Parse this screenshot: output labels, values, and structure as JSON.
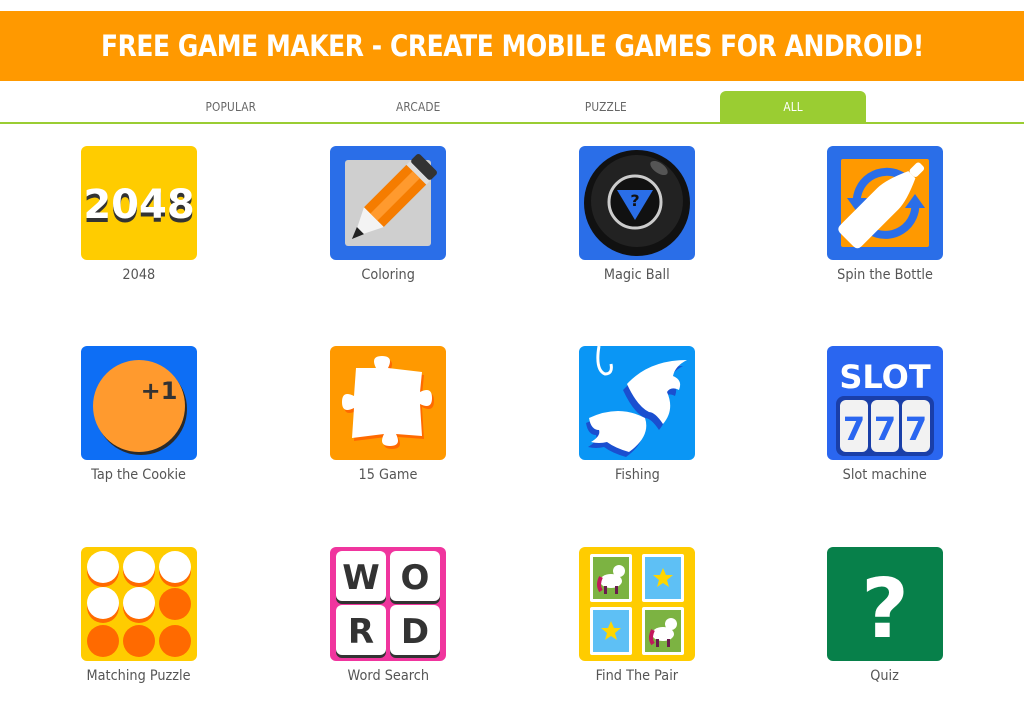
{
  "banner": {
    "title": "FREE GAME MAKER - CREATE MOBILE GAMES FOR ANDROID!"
  },
  "tabs": [
    {
      "label": "POPULAR",
      "active": false
    },
    {
      "label": "ARCADE",
      "active": false
    },
    {
      "label": "PUZZLE",
      "active": false
    },
    {
      "label": "ALL",
      "active": true
    }
  ],
  "colors": {
    "banner": "#ff9900",
    "tab_active": "#9acd32",
    "label_text": "#555555"
  },
  "games": [
    {
      "name": "2048",
      "icon": "2048-tile-icon",
      "icon_text": "2048"
    },
    {
      "name": "Coloring",
      "icon": "pencil-icon"
    },
    {
      "name": "Magic Ball",
      "icon": "magic-8-ball-icon",
      "icon_text": "?"
    },
    {
      "name": "Spin the Bottle",
      "icon": "spinning-bottle-icon"
    },
    {
      "name": "Tap the Cookie",
      "icon": "cookie-icon",
      "icon_text": "+1"
    },
    {
      "name": "15 Game",
      "icon": "puzzle-piece-icon"
    },
    {
      "name": "Fishing",
      "icon": "fish-hook-icon"
    },
    {
      "name": "Slot machine",
      "icon": "slot-machine-icon",
      "icon_text": "SLOT",
      "reels": [
        "7",
        "7",
        "7"
      ]
    },
    {
      "name": "Matching Puzzle",
      "icon": "circles-grid-icon"
    },
    {
      "name": "Word Search",
      "icon": "word-tiles-icon",
      "letters": [
        "W",
        "O",
        "R",
        "D"
      ]
    },
    {
      "name": "Find The Pair",
      "icon": "memory-cards-icon"
    },
    {
      "name": "Quiz",
      "icon": "question-mark-icon",
      "icon_text": "?"
    }
  ]
}
